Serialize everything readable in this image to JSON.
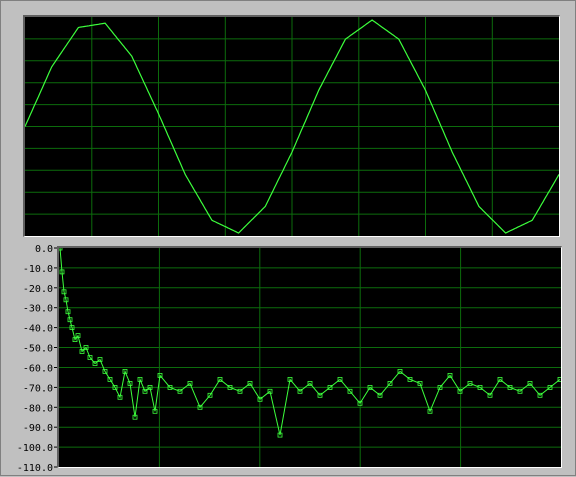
{
  "colors": {
    "panel_bg": "#c0c0c0",
    "plot_bg": "#000000",
    "grid": "#0c6c0c",
    "trace": "#3cff3c"
  },
  "chart_data": [
    {
      "type": "line",
      "title": "",
      "xlabel": "",
      "ylabel": "",
      "grid": true,
      "xlim": [
        0,
        500
      ],
      "ylim": [
        -1,
        1
      ],
      "series": [
        {
          "x": [
            0,
            25,
            50,
            75,
            100,
            125,
            150,
            175,
            200,
            225,
            250,
            275,
            300,
            325,
            350,
            375,
            400,
            425,
            450,
            475,
            500
          ],
          "values": [
            0.0,
            0.56,
            0.93,
            0.97,
            0.66,
            0.12,
            -0.45,
            -0.88,
            -1.0,
            -0.75,
            -0.24,
            0.34,
            0.82,
            1.0,
            0.82,
            0.34,
            -0.24,
            -0.75,
            -1.0,
            -0.88,
            -0.45
          ]
        }
      ]
    },
    {
      "type": "line",
      "title": "",
      "xlabel": "",
      "ylabel": "",
      "grid": true,
      "xlim": [
        0,
        500
      ],
      "ylim": [
        -110,
        0
      ],
      "yticks": [
        "0.0",
        "-10.0",
        "-20.0",
        "-30.0",
        "-40.0",
        "-50.0",
        "-60.0",
        "-70.0",
        "-80.0",
        "-90.0",
        "-100.0",
        "-110.0"
      ],
      "markers": "square",
      "series": [
        {
          "x": [
            0,
            2,
            4,
            6,
            8,
            10,
            12,
            15,
            18,
            22,
            26,
            30,
            35,
            40,
            45,
            50,
            55,
            60,
            65,
            70,
            75,
            80,
            85,
            90,
            95,
            100,
            110,
            120,
            130,
            140,
            150,
            160,
            170,
            180,
            190,
            200,
            210,
            220,
            230,
            240,
            250,
            260,
            270,
            280,
            290,
            300,
            310,
            320,
            330,
            340,
            350,
            360,
            370,
            380,
            390,
            400,
            410,
            420,
            430,
            440,
            450,
            460,
            470,
            480,
            490,
            500
          ],
          "values": [
            0,
            -12,
            -22,
            -26,
            -32,
            -36,
            -40,
            -46,
            -44,
            -52,
            -50,
            -55,
            -58,
            -56,
            -62,
            -66,
            -70,
            -75,
            -62,
            -68,
            -85,
            -66,
            -72,
            -70,
            -82,
            -64,
            -70,
            -72,
            -68,
            -80,
            -74,
            -66,
            -70,
            -72,
            -68,
            -76,
            -72,
            -94,
            -66,
            -72,
            -68,
            -74,
            -70,
            -66,
            -72,
            -78,
            -70,
            -74,
            -68,
            -62,
            -66,
            -68,
            -82,
            -70,
            -64,
            -72,
            -68,
            -70,
            -74,
            -66,
            -70,
            -72,
            -68,
            -74,
            -70,
            -66
          ]
        }
      ]
    }
  ]
}
